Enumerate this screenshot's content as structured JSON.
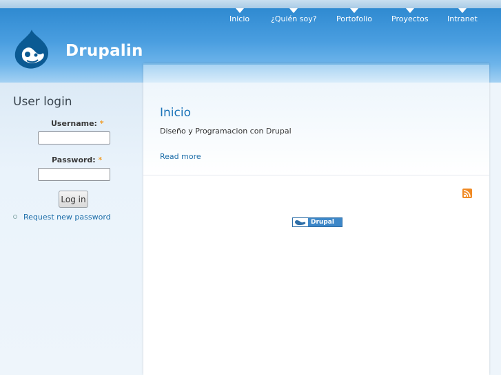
{
  "site": {
    "name": "Drupalin",
    "logo_icon": "drupal-drop-icon"
  },
  "nav": {
    "items": [
      {
        "label": "Inicio"
      },
      {
        "label": "¿Quién soy?"
      },
      {
        "label": "Portofolio"
      },
      {
        "label": "Proyectos"
      },
      {
        "label": "Intranet"
      }
    ]
  },
  "sidebar": {
    "title": "User login",
    "username_label": "Username:",
    "password_label": "Password:",
    "required_mark": "*",
    "username_value": "",
    "password_value": "",
    "login_button": "Log in",
    "request_password_link": "Request new password"
  },
  "node": {
    "title": "Inicio",
    "body": "Diseño y Programacion con Drupal",
    "read_more": "Read more"
  },
  "footer": {
    "rss_icon": "rss-feed-icon",
    "powered_by": "Drupal"
  },
  "colors": {
    "header_blue": "#3a93d8",
    "link_blue": "#1a6ca8",
    "rss_orange": "#f08a24"
  }
}
